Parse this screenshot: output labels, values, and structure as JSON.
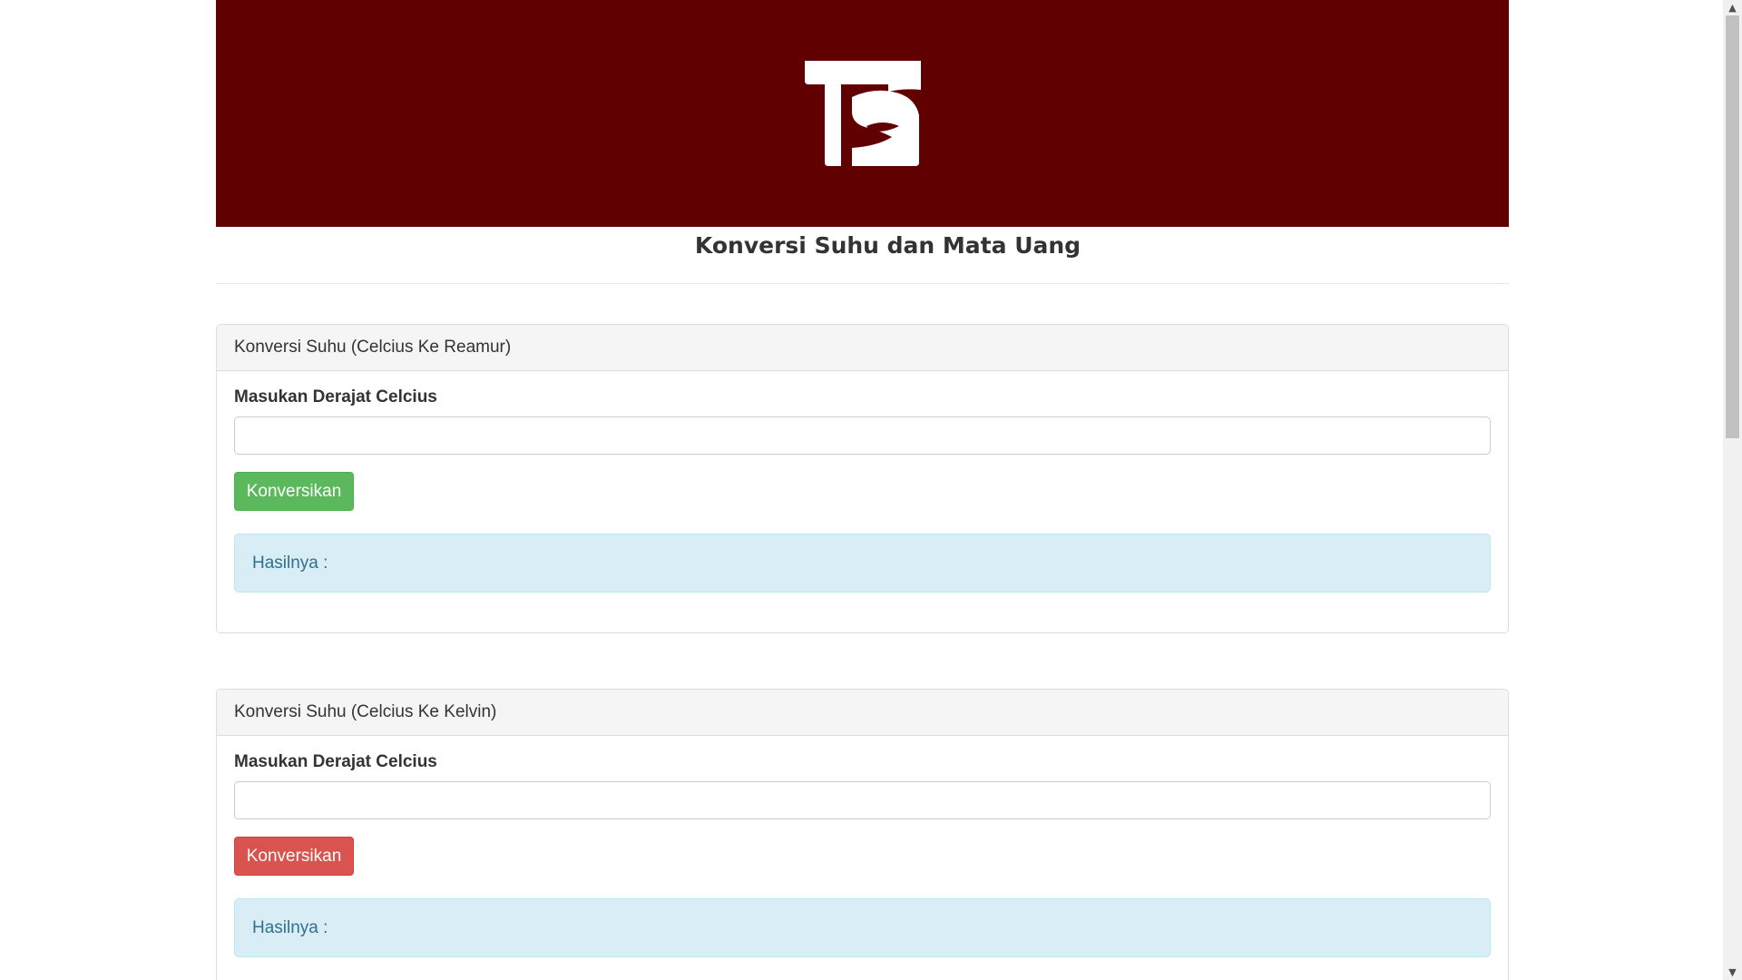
{
  "header": {
    "logo_icon": "ts-logo-icon",
    "brand_color": "#600000",
    "title": "Konversi Suhu dan Mata Uang"
  },
  "panels": [
    {
      "heading": "Konversi Suhu (Celcius Ke Reamur)",
      "input_label": "Masukan Derajat Celcius",
      "input_value": "",
      "button_label": "Konversikan",
      "button_color": "#5cb85c",
      "result_text": "Hasilnya :"
    },
    {
      "heading": "Konversi Suhu (Celcius Ke Kelvin)",
      "input_label": "Masukan Derajat Celcius",
      "input_value": "",
      "button_label": "Konversikan",
      "button_color": "#d9534f",
      "result_text": "Hasilnya :"
    }
  ],
  "scrollbar": {
    "up_icon": "chevron-up-icon",
    "down_icon": "chevron-down-icon"
  }
}
